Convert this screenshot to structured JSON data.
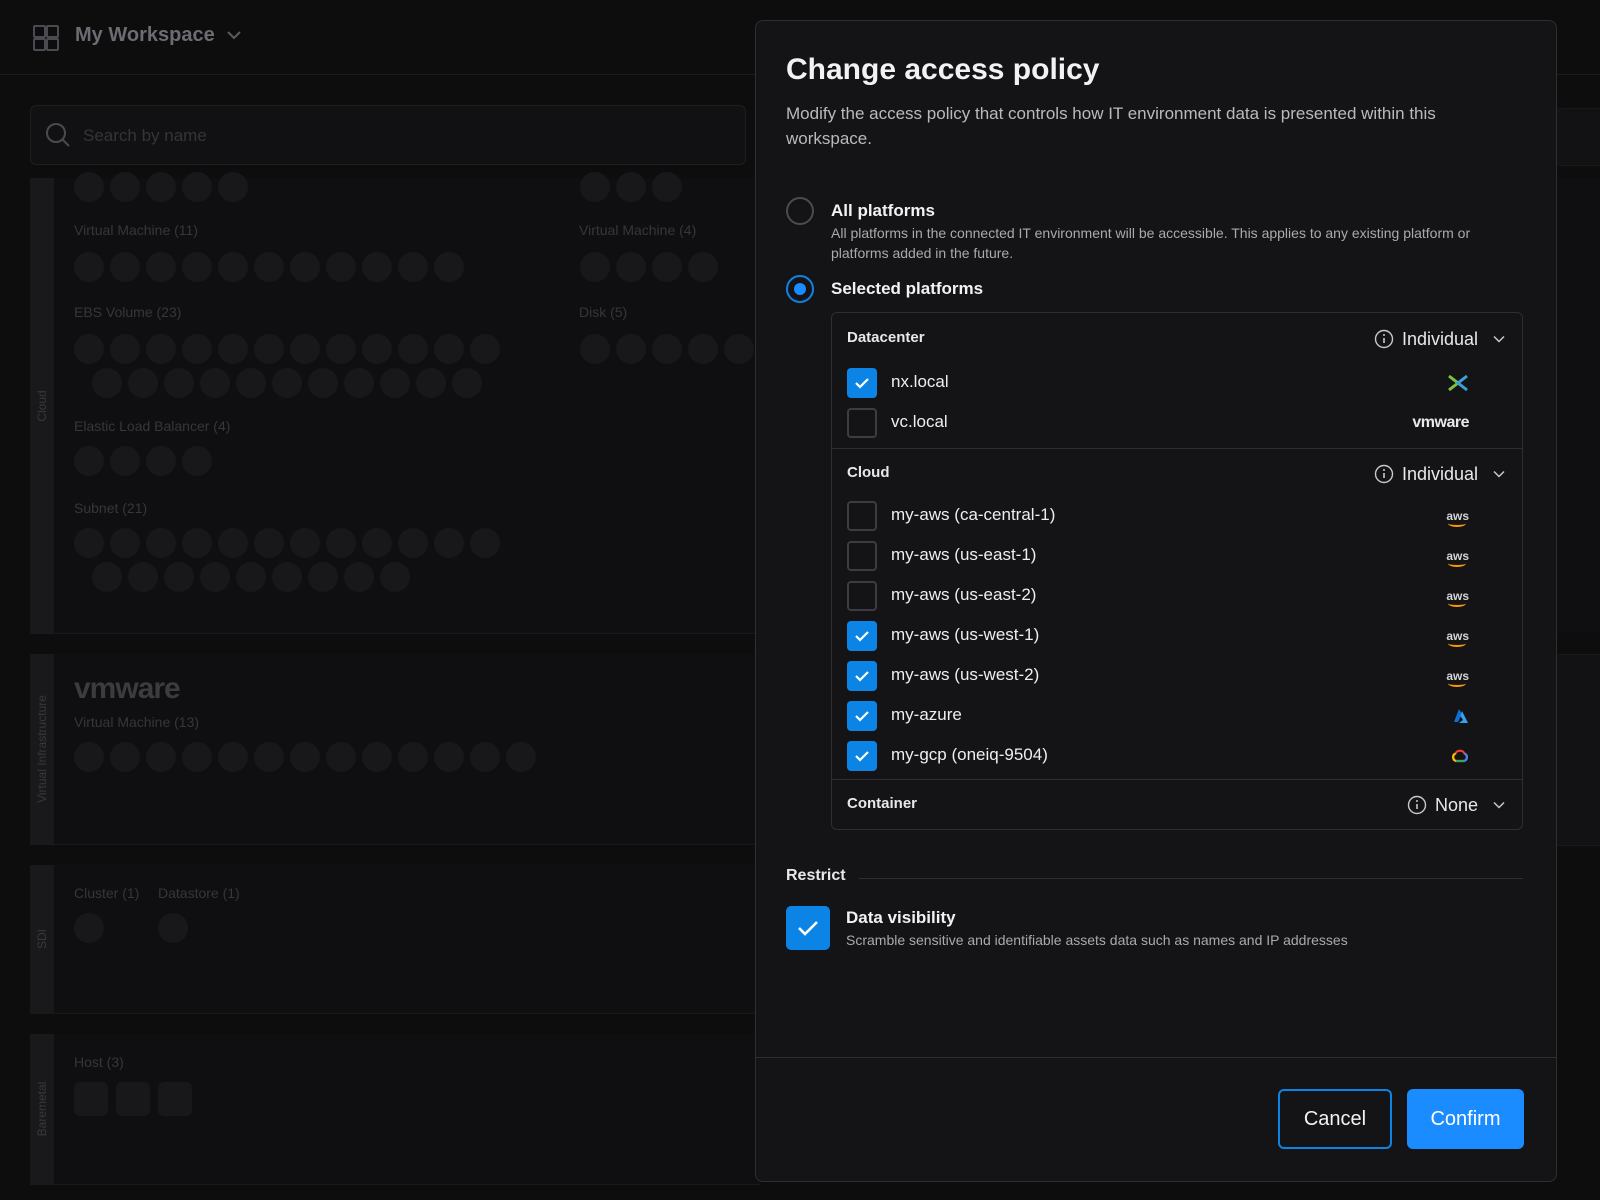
{
  "workspace": {
    "title": "My Workspace",
    "search_placeholder": "Search by name"
  },
  "background": {
    "sections": [
      {
        "tab": "Cloud",
        "resources": [
          "Virtual Machine (11)",
          "Virtual Machine (4)",
          "EBS Volume (23)",
          "Disk (5)",
          "Elastic Load Balancer (4)",
          "Subnet (21)"
        ]
      },
      {
        "tab": "Virtual Infrastructure",
        "logo": "vmware",
        "resources": [
          "Virtual Machine (13)"
        ]
      },
      {
        "tab": "SDI",
        "resources": [
          "Cluster (1)",
          "Datastore (1)"
        ]
      },
      {
        "tab": "Baremetal",
        "resources": [
          "Host (3)"
        ]
      }
    ]
  },
  "modal": {
    "title": "Change access policy",
    "description": "Modify the access policy that controls how IT environment data is presented within this workspace.",
    "options": [
      {
        "label": "All platforms",
        "description": "All platforms in the connected IT environment will be accessible. This applies to any existing platform or platforms added in the future.",
        "selected": false
      },
      {
        "label": "Selected platforms",
        "selected": true
      }
    ],
    "groups": [
      {
        "title": "Datacenter",
        "mode": "Individual",
        "items": [
          {
            "label": "nx.local",
            "checked": true,
            "logo": "nutanix-icon"
          },
          {
            "label": "vc.local",
            "checked": false,
            "logo": "vmware-icon",
            "logo_text": "vmware"
          }
        ]
      },
      {
        "title": "Cloud",
        "mode": "Individual",
        "items": [
          {
            "label": "my-aws (ca-central-1)",
            "checked": false,
            "logo": "aws-icon",
            "logo_text": "aws"
          },
          {
            "label": "my-aws (us-east-1)",
            "checked": false,
            "logo": "aws-icon",
            "logo_text": "aws"
          },
          {
            "label": "my-aws (us-east-2)",
            "checked": false,
            "logo": "aws-icon",
            "logo_text": "aws"
          },
          {
            "label": "my-aws (us-west-1)",
            "checked": true,
            "logo": "aws-icon",
            "logo_text": "aws"
          },
          {
            "label": "my-aws (us-west-2)",
            "checked": true,
            "logo": "aws-icon",
            "logo_text": "aws"
          },
          {
            "label": "my-azure",
            "checked": true,
            "logo": "azure-icon"
          },
          {
            "label": "my-gcp (oneiq-9504)",
            "checked": true,
            "logo": "gcp-icon"
          }
        ]
      },
      {
        "title": "Container",
        "mode": "None",
        "items": []
      }
    ],
    "restrict": {
      "heading": "Restrict",
      "title": "Data visibility",
      "description": "Scramble sensitive and identifiable assets data such as names and IP addresses",
      "checked": true
    },
    "buttons": {
      "cancel": "Cancel",
      "confirm": "Confirm"
    }
  },
  "colors": {
    "accent": "#0b84e6",
    "background": "#0d0d0e",
    "modal": "#141416",
    "border": "#2e2e33"
  }
}
